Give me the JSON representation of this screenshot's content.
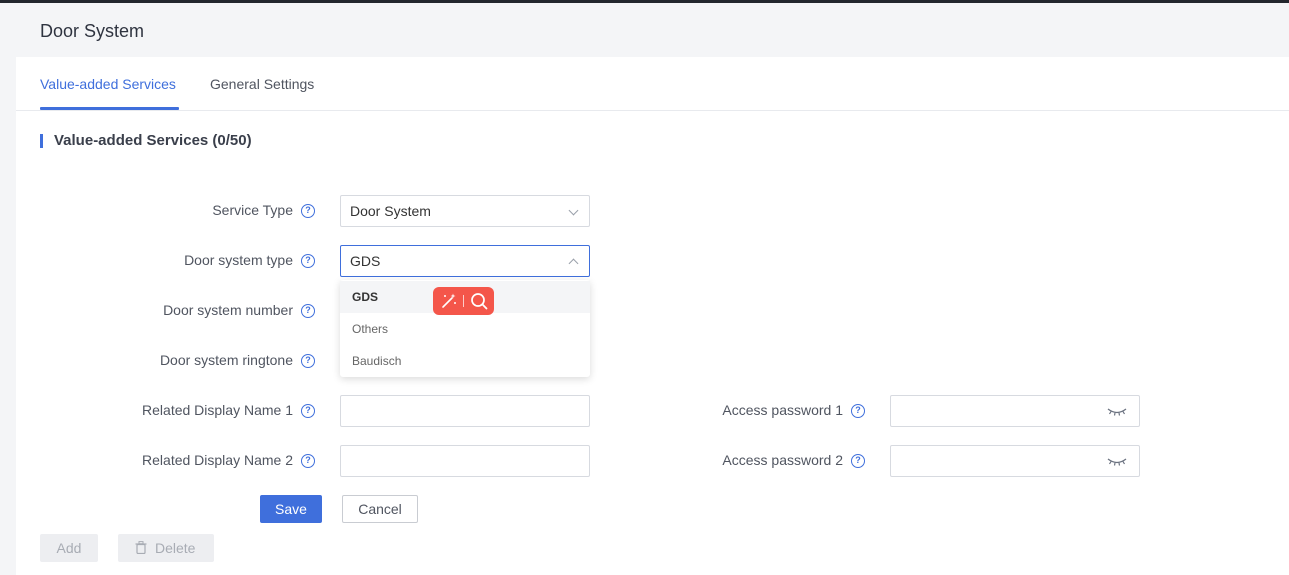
{
  "header": {
    "title": "Door System"
  },
  "tabs": [
    {
      "label": "Value-added Services",
      "active": true
    },
    {
      "label": "General Settings",
      "active": false
    }
  ],
  "section": {
    "title": "Value-added Services (0/50)"
  },
  "form": {
    "service_type": {
      "label": "Service Type",
      "value": "Door System"
    },
    "door_system_type": {
      "label": "Door system type",
      "value": "GDS",
      "options": [
        "GDS",
        "Others",
        "Baudisch"
      ]
    },
    "door_system_number": {
      "label": "Door system number"
    },
    "door_system_ringtone": {
      "label": "Door system ringtone"
    },
    "related_display_name_1": {
      "label": "Related Display Name 1",
      "value": ""
    },
    "related_display_name_2": {
      "label": "Related Display Name 2",
      "value": ""
    },
    "access_password_1": {
      "label": "Access password 1",
      "value": ""
    },
    "access_password_2": {
      "label": "Access password 2",
      "value": ""
    }
  },
  "buttons": {
    "save": "Save",
    "cancel": "Cancel",
    "add": "Add",
    "delete": "Delete"
  },
  "colors": {
    "accent": "#3f6fdc",
    "float_tool": "#f4564a"
  },
  "icons": {
    "help": "question-circle-icon",
    "eye": "eye-closed-icon",
    "trash": "trash-icon",
    "magic": "magic-wand-icon",
    "search": "search-icon"
  }
}
